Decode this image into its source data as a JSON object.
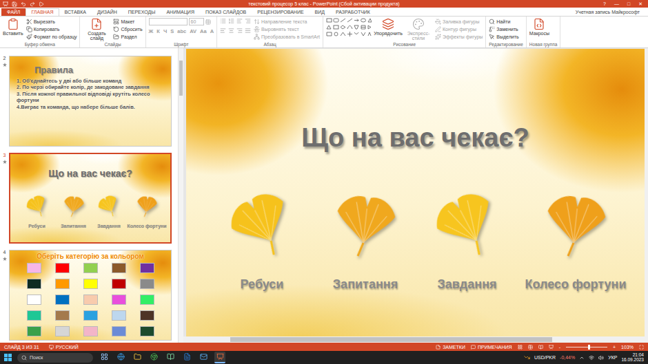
{
  "window": {
    "title": "текстовий процесор 5 клас - PowerPoint (Сбой активации продукта)",
    "controls": [
      "?",
      "—",
      "□",
      "✕"
    ]
  },
  "ribbon_tabs": [
    {
      "label": "ФАЙЛ",
      "selected": false,
      "kind": "file"
    },
    {
      "label": "ГЛАВНАЯ",
      "selected": true,
      "kind": "tab"
    },
    {
      "label": "ВСТАВКА",
      "selected": false,
      "kind": "tab"
    },
    {
      "label": "ДИЗАЙН",
      "selected": false,
      "kind": "tab"
    },
    {
      "label": "ПЕРЕХОДЫ",
      "selected": false,
      "kind": "tab"
    },
    {
      "label": "АНИМАЦИЯ",
      "selected": false,
      "kind": "tab"
    },
    {
      "label": "ПОКАЗ СЛАЙДОВ",
      "selected": false,
      "kind": "tab"
    },
    {
      "label": "РЕЦЕНЗИРОВАНИЕ",
      "selected": false,
      "kind": "tab"
    },
    {
      "label": "ВИД",
      "selected": false,
      "kind": "tab"
    },
    {
      "label": "РАЗРАБОТЧИК",
      "selected": false,
      "kind": "tab"
    }
  ],
  "account": "Учетная запись Майкрософт",
  "ribbon_groups": [
    {
      "label": "Буфер обмена",
      "kind": "clipboard",
      "disabled": false,
      "items": [
        {
          "label": "Вставить",
          "kind": "large",
          "disabled": false
        },
        {
          "label": "Вырезать",
          "kind": "small",
          "disabled": false
        },
        {
          "label": "Копировать",
          "kind": "small",
          "disabled": false
        },
        {
          "label": "Формат по образцу",
          "kind": "small",
          "disabled": false
        }
      ]
    },
    {
      "label": "Слайды",
      "kind": "slides",
      "disabled": false,
      "items": [
        {
          "label": "Создать слайд",
          "kind": "large",
          "disabled": false
        },
        {
          "label": "Макет",
          "kind": "small",
          "disabled": false
        },
        {
          "label": "Сбросить",
          "kind": "small",
          "disabled": false
        },
        {
          "label": "Раздел",
          "kind": "small",
          "disabled": false
        }
      ]
    },
    {
      "label": "Шрифт",
      "kind": "font",
      "disabled": true,
      "font_size": "60",
      "glyphs": [
        "Ж",
        "К",
        "Ч",
        "S",
        "abc",
        "AV",
        "Aa",
        "A"
      ],
      "items": []
    },
    {
      "label": "Абзац",
      "kind": "paragraph",
      "disabled": true,
      "items": [
        {
          "label": "Направление текста",
          "kind": "small",
          "disabled": true
        },
        {
          "label": "Выровнять текст",
          "kind": "small",
          "disabled": true
        },
        {
          "label": "Преобразовать в SmartArt",
          "kind": "small",
          "disabled": true
        }
      ]
    },
    {
      "label": "Рисование",
      "kind": "drawing",
      "disabled": false,
      "items": [
        {
          "label": "Упорядочить",
          "kind": "large",
          "disabled": false
        },
        {
          "label": "Экспресс-стили",
          "kind": "large",
          "disabled": true
        },
        {
          "label": "Заливка фигуры",
          "kind": "small",
          "disabled": true
        },
        {
          "label": "Контур фигуры",
          "kind": "small",
          "disabled": true
        },
        {
          "label": "Эффекты фигуры",
          "kind": "small",
          "disabled": true
        }
      ]
    },
    {
      "label": "Редактирование",
      "kind": "editing",
      "disabled": false,
      "items": [
        {
          "label": "Найти",
          "kind": "small",
          "disabled": false
        },
        {
          "label": "Заменить",
          "kind": "small",
          "disabled": false
        },
        {
          "label": "Выделить",
          "kind": "small",
          "disabled": false
        }
      ]
    },
    {
      "label": "Новая группа",
      "kind": "custom",
      "disabled": false,
      "items": [
        {
          "label": "Макросы",
          "kind": "large",
          "disabled": false
        }
      ]
    }
  ],
  "slide_panel_scroll": {
    "position": 0.04,
    "size": 0.12
  },
  "workspace_scroll": {
    "position": 0.1,
    "size": 0.7
  },
  "slides": [
    {
      "number": "2",
      "animated": true,
      "selected": false,
      "kind": "rules",
      "title": "Правила",
      "lines": [
        "1. Об'єднайтесь у дві або більше команд",
        "2. По черзі обирайте колір, де закодоване завдання",
        "3. Після кожної правильної відповіді крутіть колесо фортуни",
        "4.Виграє та команда, що набере більше балів."
      ]
    },
    {
      "number": "3",
      "animated": true,
      "selected": true,
      "kind": "menu",
      "title": "Що на вас чекає?",
      "items": [
        {
          "label": "Ребуси",
          "color": "#f6c21c"
        },
        {
          "label": "Запитання",
          "color": "#f0a81e"
        },
        {
          "label": "Завдання",
          "color": "#f7c51f"
        },
        {
          "label": "Колесо фортуни",
          "color": "#efa01b"
        }
      ]
    },
    {
      "number": "4",
      "animated": true,
      "selected": false,
      "kind": "colors",
      "title": "Оберіть категорію за кольором",
      "swatches": [
        {
          "color": "#f7b6e8"
        },
        {
          "color": "#ff0000"
        },
        {
          "color": "#92d050"
        },
        {
          "color": "#8b5a2b"
        },
        {
          "color": "#7030a0"
        },
        {
          "color": "#0d2b22"
        },
        {
          "color": "#ff9900"
        },
        {
          "color": "#ffff00"
        },
        {
          "color": "#c00000"
        },
        {
          "color": "#8a8a8a"
        },
        {
          "color": "#ffffff"
        },
        {
          "color": "#0070c0"
        },
        {
          "color": "#f8cbad"
        },
        {
          "color": "#e94fdc"
        },
        {
          "color": "#33ee66"
        },
        {
          "color": "#1fc795"
        },
        {
          "color": "#a47a4c"
        },
        {
          "color": "#2aa1e0"
        },
        {
          "color": "#bdd7ee"
        },
        {
          "color": "#4e3426"
        },
        {
          "color": "#3aa04a"
        },
        {
          "color": "#d6d6d6"
        },
        {
          "color": "#f3b5c8"
        },
        {
          "color": "#6b8bd6"
        },
        {
          "color": "#1d4a2c"
        }
      ]
    }
  ],
  "current_slide": {
    "title": "Що на вас чекає?",
    "items": [
      {
        "label": "Ребуси",
        "color": "#f6c21c"
      },
      {
        "label": "Запитання",
        "color": "#f0a81e"
      },
      {
        "label": "Завдання",
        "color": "#f7c51f"
      },
      {
        "label": "Колесо фортуни",
        "color": "#efa01b"
      }
    ]
  },
  "status_bar": {
    "slide": "СЛАЙД 3 ИЗ 31",
    "language": "РУССКИЙ",
    "notes": "ЗАМЕТКИ",
    "comments": "ПРИМЕЧАНИЯ",
    "zoom_out": "-",
    "zoom_in": "+",
    "zoom": "103%",
    "zoom_level": 0.53
  },
  "taskbar": {
    "search": "Поиск",
    "apps": [
      {
        "selected": false
      },
      {
        "selected": false
      },
      {
        "selected": false
      },
      {
        "selected": false
      },
      {
        "selected": false
      },
      {
        "selected": false
      },
      {
        "selected": false
      },
      {
        "selected": true
      }
    ],
    "ticker": "USD/PKR",
    "change": "-0,44%",
    "language": "УКР",
    "time": "21:04",
    "date": "16.09.2023"
  }
}
